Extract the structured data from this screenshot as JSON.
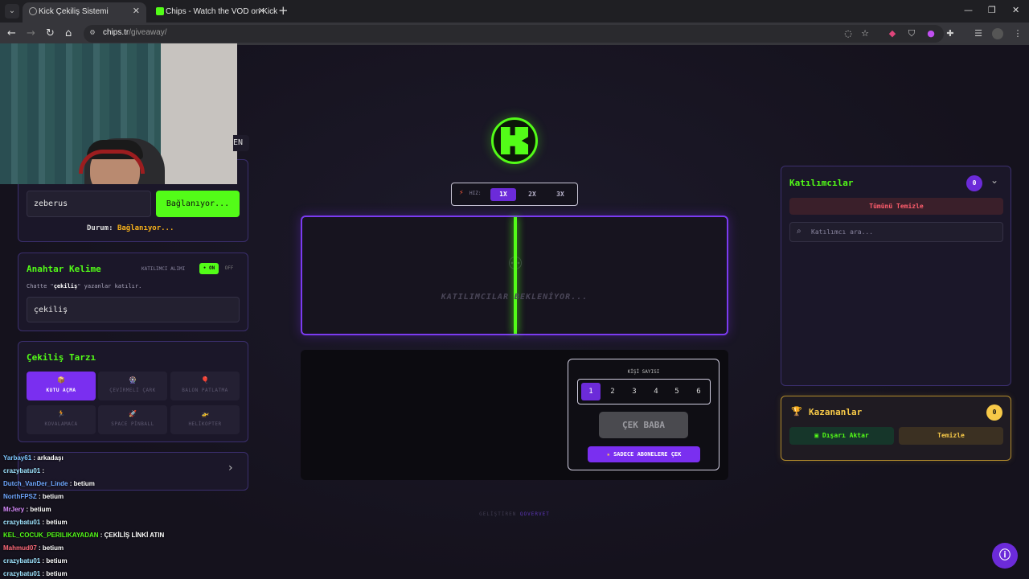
{
  "browser": {
    "tabs": [
      {
        "title": "Kick Çekiliş Sistemi",
        "close": "✕"
      },
      {
        "title": "Chips - Watch the VOD on Kick",
        "close": "✕"
      }
    ],
    "new_tab": "+",
    "window": {
      "minimize": "—",
      "maximize": "❐",
      "close": "✕"
    },
    "url_host": "chips.tr",
    "url_path": "/giveaway/"
  },
  "left": {
    "lang_tab": "EN",
    "connect": {
      "channel_value": "zeberus",
      "button_label": "Bağlanıyor...",
      "status_label": "Durum:",
      "status_value": "Bağlanıyor..."
    },
    "keyword": {
      "title": "Anahtar Kelime",
      "toggle_label": "KATILIMCI ALIMI",
      "on_label": "• ON",
      "off_label": "OFF",
      "hint_prefix": "Chatte \"",
      "hint_word": "çekiliş",
      "hint_suffix": "\" yazanlar katılır.",
      "value": "çekiliş"
    },
    "style": {
      "title": "Çekiliş Tarzı",
      "options": [
        {
          "icon": "📦",
          "label": "KUTU AÇMA"
        },
        {
          "icon": "🎡",
          "label": "ÇEVİRMELİ ÇARK"
        },
        {
          "icon": "🎈",
          "label": "BALON PATLATMA"
        },
        {
          "icon": "🏃",
          "label": "KOVALAMACA"
        },
        {
          "icon": "🚀",
          "label": "SPACE PİNBALL"
        },
        {
          "icon": "🚁",
          "label": "HELİKOPTER"
        }
      ]
    },
    "collapsed_arrow": "›"
  },
  "chat": [
    {
      "user": "Yarbay61",
      "color": "#7ec8ff",
      "msg": "arkadaşı"
    },
    {
      "user": "crazybatu01",
      "color": "#9fe4ff",
      "msg": ""
    },
    {
      "user": "Dutch_VanDer_Linde",
      "color": "#6fa8ff",
      "msg": "betium"
    },
    {
      "user": "NorthFPSZ",
      "color": "#6fa8ff",
      "msg": "betium"
    },
    {
      "user": "MrJery",
      "color": "#d98cff",
      "msg": "betium"
    },
    {
      "user": "crazybatu01",
      "color": "#9fe4ff",
      "msg": "betium"
    },
    {
      "user": "KEL_COCUK_PERILIKAYADAN",
      "color": "#53fc18",
      "msg": "ÇEKİLİŞ LİNKİ ATIN"
    },
    {
      "user": "Mahmud07",
      "color": "#ff6b7a",
      "msg": "betium"
    },
    {
      "user": "crazybatu01",
      "color": "#9fe4ff",
      "msg": "betium"
    },
    {
      "user": "crazybatu01",
      "color": "#9fe4ff",
      "msg": "betium"
    }
  ],
  "center": {
    "speed": {
      "label": "HIZ:",
      "options": [
        "1X",
        "2X",
        "3X"
      ],
      "selected": "1X"
    },
    "arena_waiting": "KATILIMCILAR BEKLENİYOR...",
    "count": {
      "title": "KİŞİ SAYISI",
      "options": [
        "1",
        "2",
        "3",
        "4",
        "5",
        "6"
      ],
      "selected": "1"
    },
    "draw_button": "ÇEK BABA",
    "subs_button": "SADECE ABONELERE ÇEK",
    "footer_prefix": "GELİŞTİREN",
    "footer_brand": "QOVERVET"
  },
  "right": {
    "participants": {
      "title": "Katılımcılar",
      "count": "0",
      "clear_all": "Tümünü Temizle",
      "search_placeholder": "Katılımcı ara..."
    },
    "winners": {
      "title": "Kazananlar",
      "count": "0",
      "export": "Dışarı Aktar",
      "clear": "Temizle"
    }
  },
  "colors": {
    "kick_green": "#53fc18",
    "purple": "#6c2bd9",
    "gold": "#b08a2c",
    "bg": "#16131f"
  }
}
